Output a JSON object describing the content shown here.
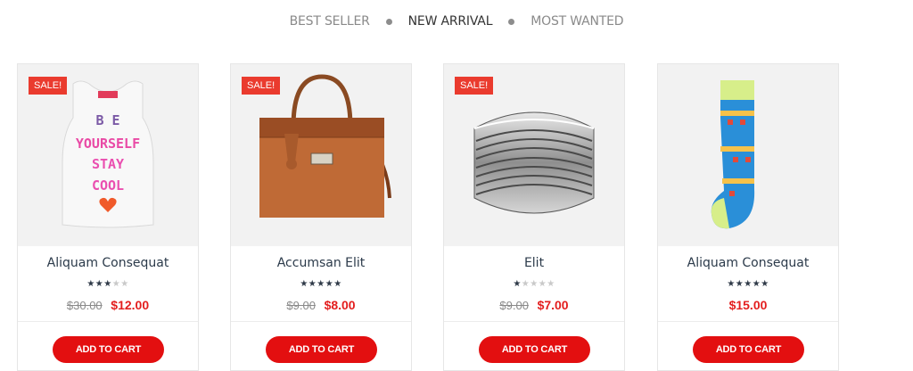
{
  "tabs": [
    {
      "label": "BEST SELLER"
    },
    {
      "label": "NEW ARRIVAL",
      "active": true
    },
    {
      "label": "MOST WANTED"
    }
  ],
  "products": [
    {
      "name": "Aliquam Consequat",
      "sale_badge": "SALE!",
      "rating": 3,
      "rating_max": 5,
      "old_price": "$30.00",
      "price": "$12.00",
      "button": "ADD TO CART",
      "image_text": [
        "B E",
        "YOURSELF",
        "STAY",
        "COOL"
      ]
    },
    {
      "name": "Accumsan Elit",
      "sale_badge": "SALE!",
      "rating": 5,
      "rating_max": 5,
      "old_price": "$9.00",
      "price": "$8.00",
      "button": "ADD TO CART"
    },
    {
      "name": "Elit",
      "sale_badge": "SALE!",
      "rating": 1,
      "rating_max": 5,
      "old_price": "$9.00",
      "price": "$7.00",
      "button": "ADD TO CART"
    },
    {
      "name": "Aliquam Consequat",
      "sale_badge": "",
      "rating": 5,
      "rating_max": 5,
      "old_price": "",
      "price": "$15.00",
      "button": "ADD TO CART"
    }
  ],
  "colors": {
    "sale": "#ea3b2e",
    "button": "#e30f10",
    "price": "#e31e1e",
    "star_on": "#2f3a48",
    "star_off": "#c9c9c9"
  }
}
